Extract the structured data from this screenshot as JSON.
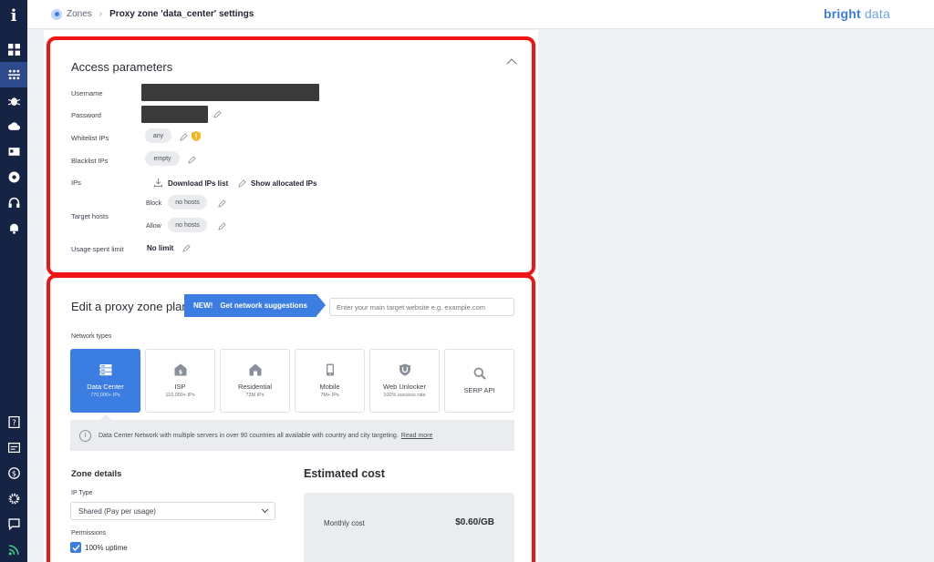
{
  "sidebar": {
    "logo": "i",
    "top_icons": [
      "dashboard-icon",
      "network-icon",
      "bug-icon",
      "cloud-icon",
      "id-card-icon",
      "browser-icon",
      "headset-icon",
      "bell-icon"
    ],
    "bottom_icons": [
      "help-book-icon",
      "billing-card-icon",
      "dollar-icon",
      "settings-gear-icon",
      "chat-icon",
      "rss-icon"
    ]
  },
  "header": {
    "breadcrumb_root": "Zones",
    "breadcrumb_current": "Proxy zone 'data_center' settings",
    "brand_bold": "bright",
    "brand_light": " data"
  },
  "access": {
    "title": "Access parameters",
    "username_label": "Username",
    "password_label": "Password",
    "whitelist_label": "Whitelist IPs",
    "whitelist_value": "any",
    "blacklist_label": "Blacklist IPs",
    "blacklist_value": "empty",
    "ips_label": "IPs",
    "download_ips": "Download IPs list",
    "show_allocated": "Show allocated IPs",
    "target_hosts_label": "Target hosts",
    "block_label": "Block",
    "block_value": "no hosts",
    "allow_label": "Allow",
    "allow_value": "no hosts",
    "usage_label": "Usage spent limit",
    "usage_value": "No limit"
  },
  "plan": {
    "title": "Edit a proxy zone plan",
    "new_tag": "NEW!",
    "suggestions_label": "Get network suggestions",
    "target_placeholder": "Enter your main target website e.g. example.com",
    "network_types_label": "Network types",
    "network_types": [
      {
        "name": "Data Center",
        "sub": "770,000+ IPs",
        "icon": "server-icon"
      },
      {
        "name": "ISP",
        "sub": "110,000+ IPs",
        "icon": "isp-home-icon"
      },
      {
        "name": "Residential",
        "sub": "72M IPs",
        "icon": "residential-home-icon"
      },
      {
        "name": "Mobile",
        "sub": "7M+ IPs",
        "icon": "mobile-icon"
      },
      {
        "name": "Web Unlocker",
        "sub": "100% success rate",
        "icon": "unlock-shield-icon"
      },
      {
        "name": "SERP API",
        "sub": "",
        "icon": "search-icon"
      }
    ],
    "info_text": "Data Center Network with multiple servers in over 90 countries all available with country and city targeting.",
    "info_link": "Read more",
    "zone_details_title": "Zone details",
    "ip_type_label": "IP Type",
    "ip_type_value": "Shared (Pay per usage)",
    "permissions_label": "Permissions",
    "uptime_label": "100% uptime",
    "estimated_cost_title": "Estimated cost",
    "monthly_cost_label": "Monthly cost",
    "monthly_cost_value": "$0.60/GB"
  },
  "colors": {
    "accent": "#3c7de2",
    "highlight_border": "#f01414",
    "sidebar_bg": "#152344"
  }
}
